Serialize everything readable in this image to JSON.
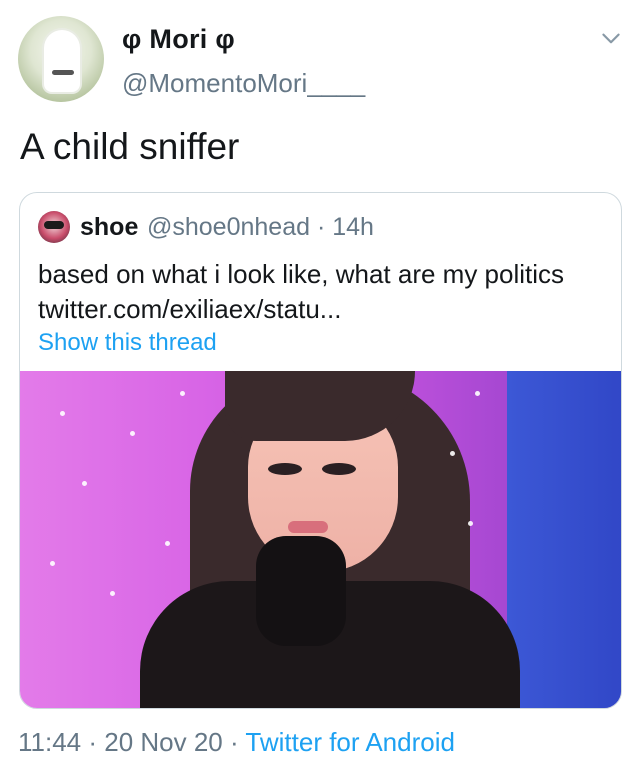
{
  "tweet": {
    "display_name": "φ Mori φ",
    "handle": "@MomentoMori____",
    "text": "A child sniffer",
    "avatar_icon": "ghost-avatar",
    "menu_icon": "chevron-down-icon"
  },
  "quoted": {
    "name": "shoe",
    "handle_time": "@shoe0nhead · 14h",
    "text_line1": "based on what i look like, what are my politics",
    "text_line2": "twitter.com/exiliaex/statu...",
    "show_thread": "Show this thread",
    "avatar_icon": "user-avatar",
    "media_icon": "photo"
  },
  "meta": {
    "time_date": "11:44 · 20 Nov 20 · ",
    "source": "Twitter for Android"
  },
  "colors": {
    "link": "#1da1f2",
    "secondary_text": "#657786",
    "border": "#cfd9de"
  }
}
